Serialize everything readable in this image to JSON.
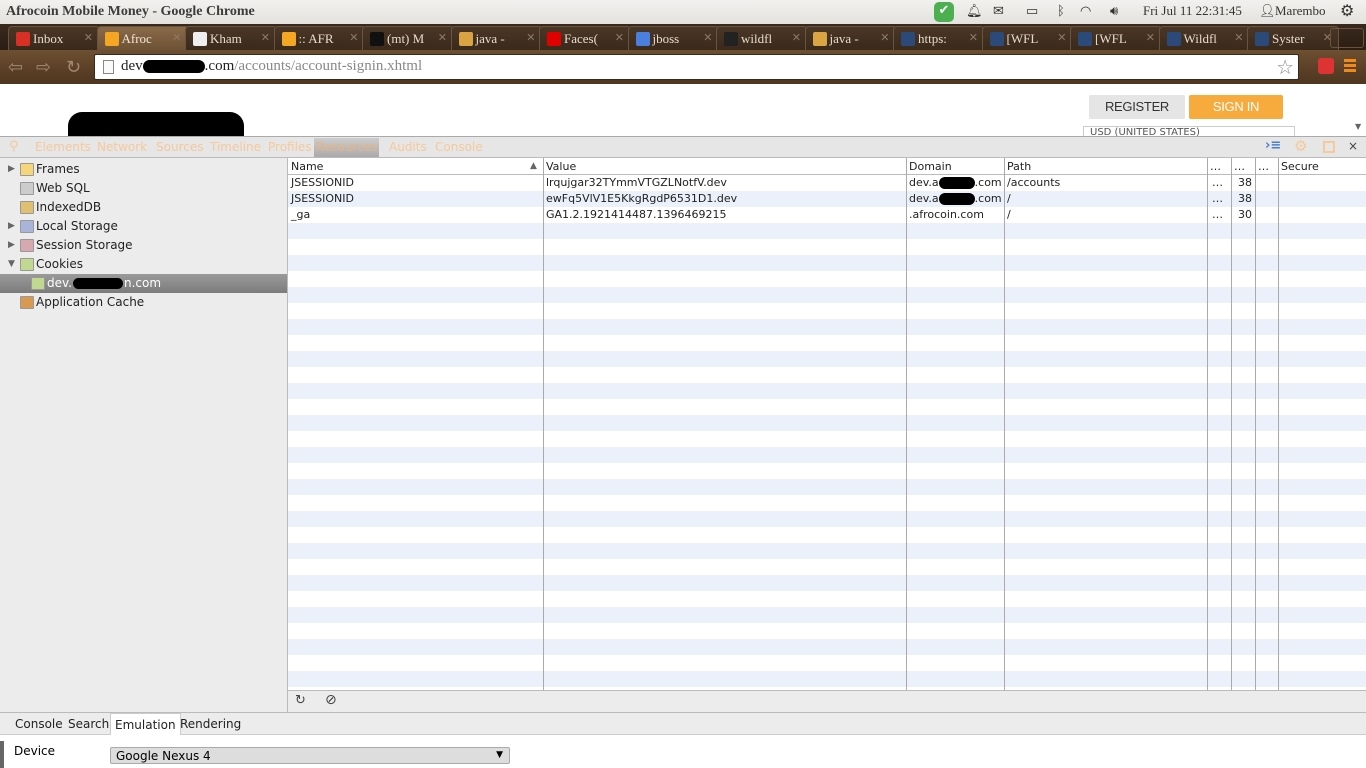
{
  "window": {
    "title": "Afrocoin Mobile Money - Google Chrome"
  },
  "system_tray": {
    "datetime": "Fri Jul 11 22:31:45",
    "user": "Marembo"
  },
  "tabs": [
    {
      "label": "Inbox",
      "color": "#d93025"
    },
    {
      "label": "Afroc",
      "color": "#f5a623",
      "active": true
    },
    {
      "label": "Kham",
      "color": "#eeeeee"
    },
    {
      "label": ":: AFR",
      "color": "#f5a623"
    },
    {
      "label": "(mt) M",
      "color": "#111111"
    },
    {
      "label": "java -",
      "color": "#d9a441"
    },
    {
      "label": "Faces(",
      "color": "#e00000"
    },
    {
      "label": "jboss",
      "color": "#4a7fe0"
    },
    {
      "label": "wildfl",
      "color": "#222222"
    },
    {
      "label": "java -",
      "color": "#d9a441"
    },
    {
      "label": "https:",
      "color": "#2b4a7a"
    },
    {
      "label": "[WFL",
      "color": "#2b4a7a"
    },
    {
      "label": "[WFL",
      "color": "#2b4a7a"
    },
    {
      "label": "Wildfl",
      "color": "#2b4a7a"
    },
    {
      "label": "Syster",
      "color": "#2b4a7a"
    }
  ],
  "address": {
    "host_prefix": "dev",
    "host_suffix": ".com",
    "path": "/accounts/account-signin.xhtml"
  },
  "page": {
    "register": "REGISTER",
    "sign_in": "SIGN IN",
    "currency": "USD (UNITED STATES)"
  },
  "devtools": {
    "tabs": [
      "Elements",
      "Network",
      "Sources",
      "Timeline",
      "Profiles",
      "Resources",
      "Audits",
      "Console"
    ],
    "selected_tab": "Resources",
    "sidebar": [
      {
        "label": "Frames",
        "icon": "folder-icon"
      },
      {
        "label": "Web SQL",
        "icon": "database-icon"
      },
      {
        "label": "IndexedDB",
        "icon": "database-icon"
      },
      {
        "label": "Local Storage",
        "icon": "table-icon"
      },
      {
        "label": "Session Storage",
        "icon": "table-icon"
      },
      {
        "label": "Cookies",
        "icon": "cookie-icon"
      },
      {
        "label": "dev.",
        "suffix": "n.com",
        "icon": "cookie-icon"
      },
      {
        "label": "Application Cache",
        "icon": "cache-icon"
      }
    ],
    "columns": [
      "Name",
      "Value",
      "Domain",
      "Path",
      "…",
      "…",
      "…",
      "Secure"
    ],
    "rows": [
      {
        "name": "JSESSIONID",
        "value": "lrqujgar32TYmmVTGZLNotfV.dev",
        "domain_prefix": "dev.a",
        "domain_suffix": ".com",
        "path": "/accounts",
        "c5": "…",
        "c6": "38"
      },
      {
        "name": "JSESSIONID",
        "value": "ewFq5VlV1E5KkgRgdP6531D1.dev",
        "domain_prefix": "dev.a",
        "domain_suffix": ".com",
        "path": "/",
        "c5": "…",
        "c6": "38"
      },
      {
        "name": "_ga",
        "value": "GA1.2.1921414487.1396469215",
        "domain_prefix": ".afrocoin.com",
        "domain_suffix": "",
        "path": "/",
        "c5": "…",
        "c6": "30"
      }
    ],
    "drawer_tabs": [
      "Console",
      "Search",
      "Emulation",
      "Rendering"
    ],
    "emulation": {
      "device_label": "Device",
      "device_value": "Google Nexus 4"
    }
  }
}
